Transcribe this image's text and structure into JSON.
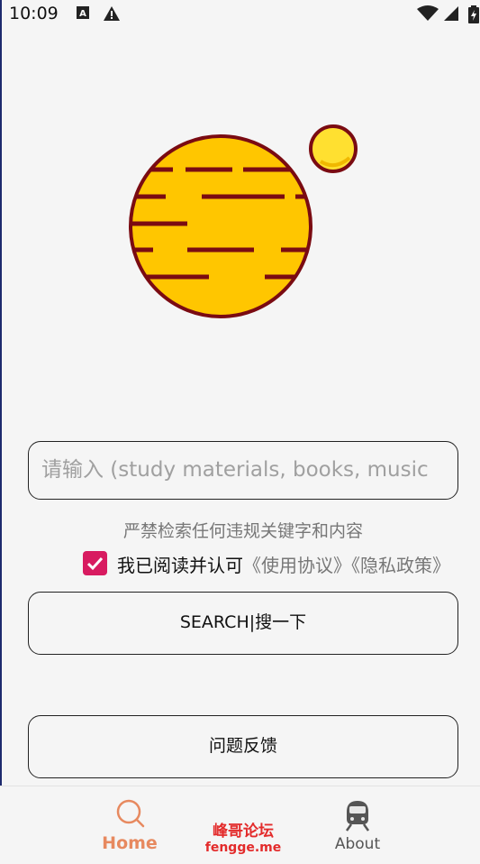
{
  "status_bar": {
    "time": "10:09"
  },
  "search": {
    "placeholder": "请输入 (study materials, books, music"
  },
  "warning_text": "严禁检索任何违规关键字和内容",
  "agreement": {
    "checked": true,
    "text": "我已阅读并认可",
    "links": "《使用协议》《隐私政策》"
  },
  "buttons": {
    "search": "SEARCH|搜一下",
    "feedback": "问题反馈"
  },
  "bottom_nav": {
    "home": "Home",
    "about": "About"
  },
  "watermark": {
    "cn": "峰哥论坛",
    "en": "fengge.me"
  },
  "colors": {
    "accent": "#d81b60",
    "nav_active": "#e7895f",
    "planet_fill": "#ffc600",
    "planet_stroke": "#7a0b12",
    "moon_fill": "#ffe030"
  },
  "icons": {
    "home": "search-icon",
    "about": "train-icon",
    "checkbox": "check-icon",
    "logo": "planet-illustration"
  }
}
